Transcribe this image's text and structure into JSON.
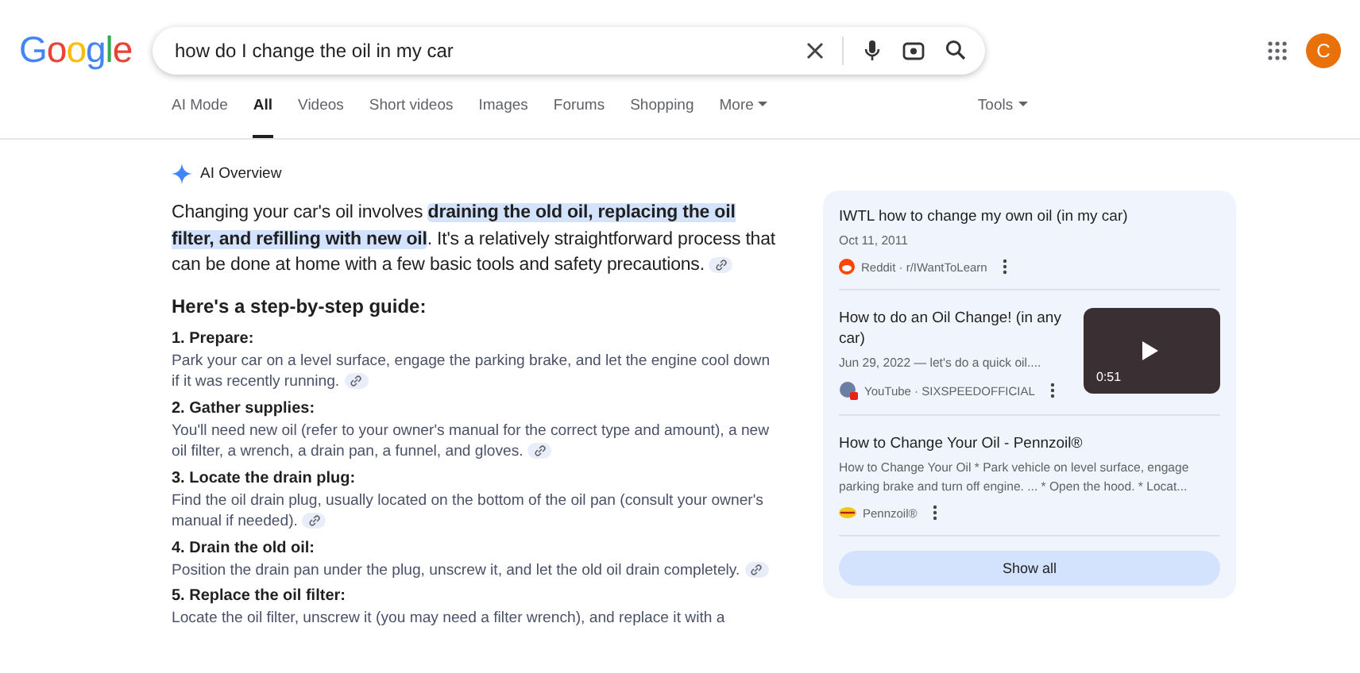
{
  "logo": "Google",
  "search": {
    "value": "how do I change the oil in my car"
  },
  "avatar": {
    "letter": "C"
  },
  "tabs": [
    {
      "label": "AI Mode",
      "selected": false,
      "kind": "tab"
    },
    {
      "label": "All",
      "selected": true,
      "kind": "tab"
    },
    {
      "label": "Videos",
      "selected": false,
      "kind": "tab"
    },
    {
      "label": "Short videos",
      "selected": false,
      "kind": "tab"
    },
    {
      "label": "Images",
      "selected": false,
      "kind": "tab"
    },
    {
      "label": "Forums",
      "selected": false,
      "kind": "tab"
    },
    {
      "label": "Shopping",
      "selected": false,
      "kind": "tab"
    },
    {
      "label": "More",
      "selected": false,
      "kind": "menu"
    }
  ],
  "tools": {
    "label": "Tools"
  },
  "overview": {
    "title": "AI Overview",
    "summary": "Changing your car's oil involves **draining the old oil, replacing the oil filter, and refilling with new oil**. It's a relatively straightforward process that can be done at home with a few basic tools and safety precautions.",
    "guide_heading": "Here's a step-by-step guide:",
    "steps": [
      {
        "title": "1. Prepare:",
        "text": "Park your car on a level surface, engage the parking brake, and let the engine cool down if it was recently running.",
        "link": true
      },
      {
        "title": "2. Gather supplies:",
        "text": "You'll need new oil (refer to your owner's manual for the correct type and amount), a new oil filter, a wrench, a drain pan, a funnel, and gloves.",
        "link": true
      },
      {
        "title": "3. Locate the drain plug:",
        "text": "Find the oil drain plug, usually located on the bottom of the oil pan (consult your owner's manual if needed).",
        "link": true
      },
      {
        "title": "4. Drain the old oil:",
        "text": "Position the drain pan under the plug, unscrew it, and let the old oil drain completely.",
        "link": true
      },
      {
        "title": "5. Replace the oil filter:",
        "text": "Locate the oil filter, unscrew it (you may need a filter wrench), and replace it with a",
        "link": false
      }
    ]
  },
  "sources": [
    {
      "kind": "forum",
      "title": "IWTL how to change my own oil (in my car)",
      "meta": "Oct 11, 2011",
      "site": "Reddit · r/IWantToLearn"
    },
    {
      "kind": "video",
      "title": "How to do an Oil Change! (in any car)",
      "meta": "Jun 29, 2022 — let's do a quick oil....",
      "site": "YouTube · SIXSPEEDOFFICIAL",
      "duration": "0:51"
    },
    {
      "kind": "article",
      "title": "How to Change Your Oil - Pennzoil®",
      "meta": "How to Change Your Oil * Park vehicle on level surface, engage parking brake and turn off engine. ... * Open the hood. * Locat...",
      "site": "Pennzoil®"
    }
  ],
  "show_all": "Show all"
}
